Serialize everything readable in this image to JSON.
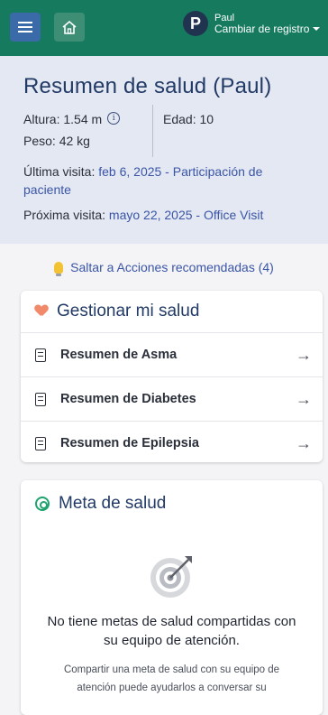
{
  "topbar": {
    "menu_icon": "hamburger-icon",
    "home_icon": "home-icon",
    "avatar_initial": "P",
    "user_name": "Paul",
    "switch_label": "Cambiar de registro",
    "color": "#167a5e"
  },
  "summary": {
    "title": "Resumen de salud (Paul)",
    "height_label": "Altura: 1.54 m",
    "age_label": "Edad: 10",
    "weight_label": "Peso: 42 kg",
    "last_visit_prefix": "Última visita: ",
    "last_visit_link": "feb 6, 2025 - Participación de paciente",
    "next_visit_prefix": "Próxima visita: ",
    "next_visit_link": "mayo 22, 2025 - Office Visit"
  },
  "recommendations": {
    "link": "Saltar a Acciones recomendadas (4)"
  },
  "manage": {
    "title": "Gestionar mi salud",
    "items": [
      {
        "label": "Resumen de Asma"
      },
      {
        "label": "Resumen de Diabetes"
      },
      {
        "label": "Resumen de Epilepsia"
      }
    ]
  },
  "goal": {
    "title": "Meta de salud",
    "empty_title": "No tiene metas de salud compartidas con su equipo de atención.",
    "empty_desc": "Compartir una meta de salud con su equipo de atención puede ayudarlos a conversar su"
  },
  "colors": {
    "accent": "#167a5e",
    "link": "#3a55a6",
    "heading": "#223a66",
    "summary_bg": "#e4e8f2"
  }
}
